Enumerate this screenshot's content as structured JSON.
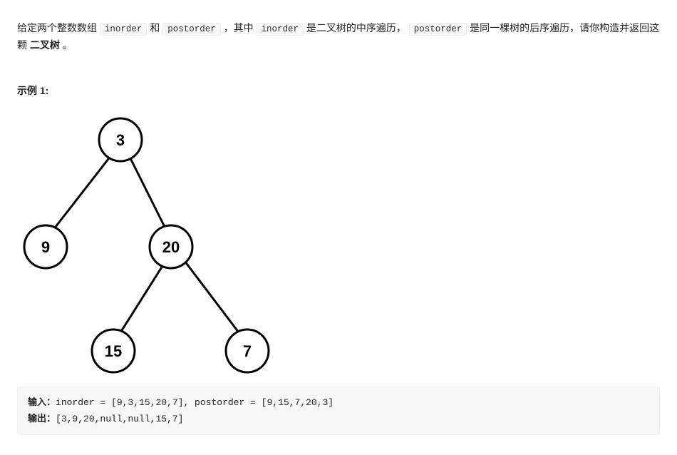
{
  "description": {
    "text1": "给定两个整数数组 ",
    "code1": "inorder",
    "text2": " 和 ",
    "code2": "postorder",
    "text3": " ，其中 ",
    "code3": "inorder",
    "text4": " 是二叉树的中序遍历， ",
    "code4": "postorder",
    "text5": " 是同一棵树的后序遍历，请你构造并返回这颗 ",
    "emph": "二叉树",
    "text6": " 。"
  },
  "example": {
    "title": "示例 1:",
    "inputLabel": "输入：",
    "inputValue": "inorder = [9,3,15,20,7], postorder = [9,15,7,20,3]",
    "outputLabel": "输出：",
    "outputValue": "[3,9,20,null,null,15,7]"
  },
  "tree": {
    "nodes": {
      "n3": "3",
      "n9": "9",
      "n20": "20",
      "n15": "15",
      "n7": "7"
    }
  }
}
